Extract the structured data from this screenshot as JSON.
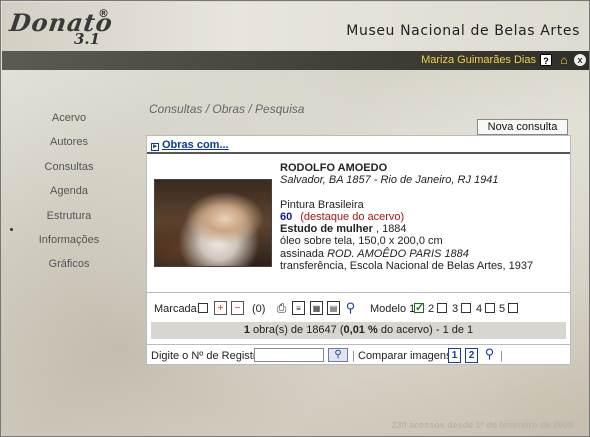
{
  "app": {
    "logo_text": "Donato",
    "logo_registered": "®",
    "logo_version": "3.1",
    "museum_title": "Museu Nacional de Belas Artes"
  },
  "userbar": {
    "username": "Mariza Guimarães Dias",
    "help_icon": "?",
    "home_icon": "⌂",
    "close_icon": "x"
  },
  "sidebar": {
    "items": [
      {
        "label": "Acervo"
      },
      {
        "label": "Autores"
      },
      {
        "label": "Consultas"
      },
      {
        "label": "Agenda"
      },
      {
        "label": "Estrutura"
      },
      {
        "label": "Informações"
      },
      {
        "label": "Gráficos"
      }
    ]
  },
  "main": {
    "breadcrumb": "Consultas / Obras / Pesquisa",
    "new_query_button": "Nova consulta",
    "obras_link": "Obras com...",
    "record": {
      "artist": "RODOLFO AMOEDO",
      "birth_death": "Salvador, BA 1857 - Rio de Janeiro, RJ 1941",
      "school": "Pintura Brasileira",
      "number": "60",
      "highlight": "(destaque do acervo)",
      "title": "Estudo de mulher",
      "year": " , 1884",
      "technique": "óleo sobre tela, 150,0 x 200,0 cm",
      "signature_prefix": "assinada ",
      "signature": "ROD. AMOÊDO PARIS 1884",
      "acquisition": "transferência, Escola Nacional de Belas Artes, 1937"
    },
    "toolbar": {
      "marcada_label": "Marcada:",
      "marked_count": "(0)",
      "modelo_label": "Modelo 1",
      "model_options": [
        "2",
        "3",
        "4",
        "5"
      ],
      "selected_model": "1"
    },
    "result_count": {
      "prefix": "1",
      "middle": " obra(s) de 18647  (",
      "percent": "0,01 %",
      "suffix": " do acervo) - 1 de 1"
    },
    "register": {
      "label": "Digite o Nº de Registro:",
      "input_value": "",
      "go_icon": "⚲",
      "compare_label": "Comparar imagens:",
      "compare_1": "1",
      "compare_2": "2"
    },
    "footer_text": "230 acessos desde 1º de fevereiro de 2008"
  },
  "colors": {
    "username": "#f0d24a",
    "link": "#0a3a9a",
    "highlight": "#a01818",
    "record_number": "#1a1a8a"
  }
}
